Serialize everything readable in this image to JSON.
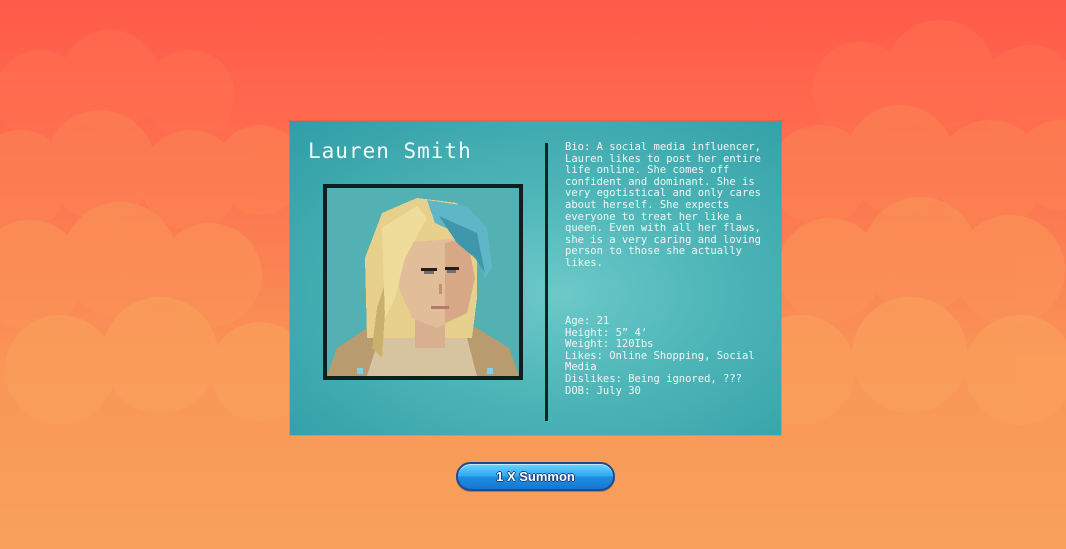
{
  "character": {
    "name": "Lauren Smith",
    "bio": "Bio: A social media influencer, Lauren likes to post her entire life online. She comes off confident and dominant. She is very egotistical and only cares about herself. She expects everyone to treat her like a queen. Even with all her flaws, she is a very caring and loving person to those she actually likes.",
    "stats": {
      "age": "Age: 21",
      "height": "Height: 5” 4’",
      "weight": "Weight: 120Ibs",
      "likes": "Likes: Online Shopping, Social Media",
      "dislikes": "Dislikes: Being ignored, ???",
      "dob": "DOB: July 30"
    }
  },
  "actions": {
    "summon_label": "1 X Summon"
  },
  "colors": {
    "background_top": "#ff5a4a",
    "background_bottom": "#f8a15c",
    "card": "#4cb4b7",
    "button": "#2ea8f2"
  }
}
